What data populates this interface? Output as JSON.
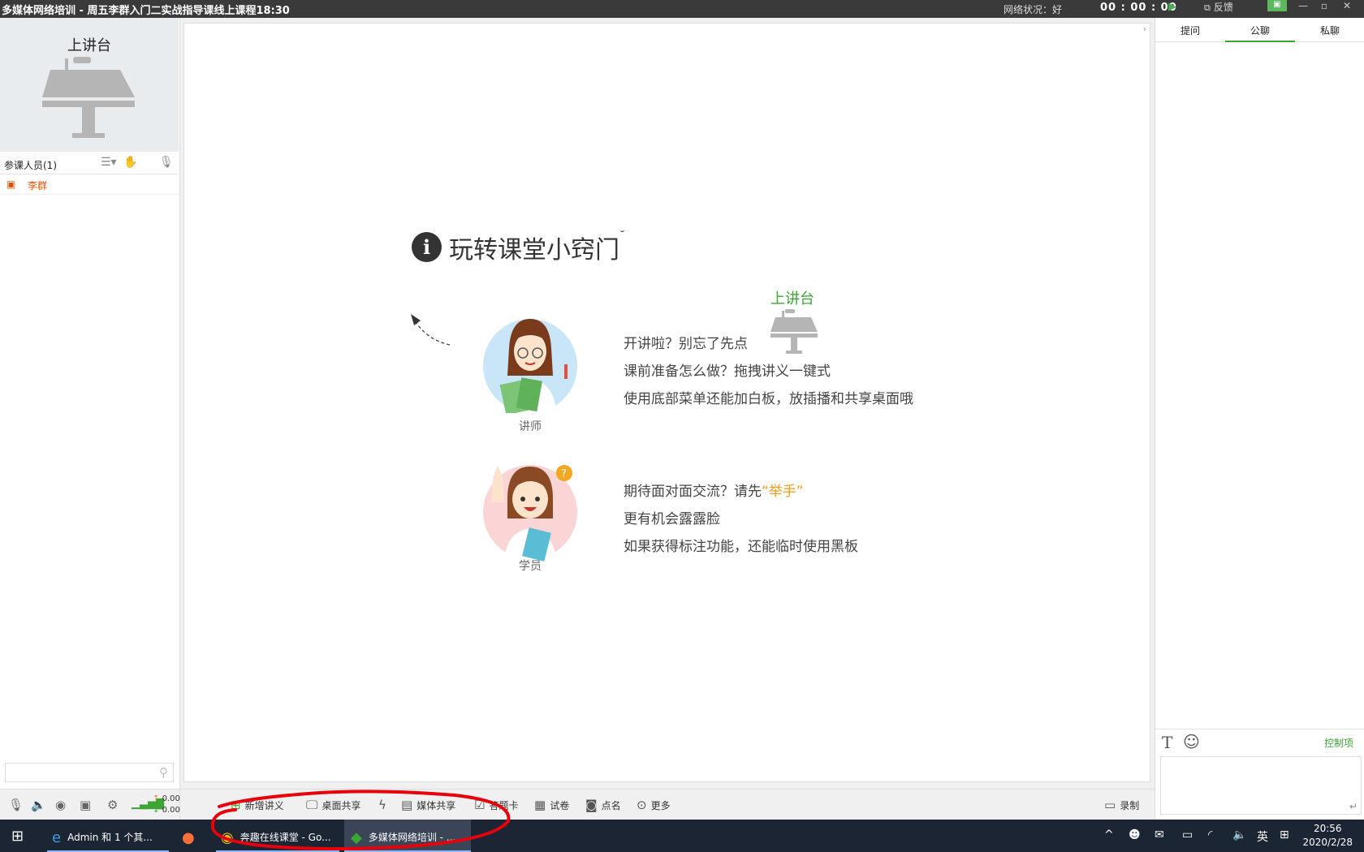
{
  "titlebar": {
    "title": "多媒体网络培训 - 周五李群入门二实战指导课线上课程18:30",
    "network_status": "网络状况：好",
    "timer": "00 : 00 : 00",
    "feedback": "反馈"
  },
  "left": {
    "podium_title": "上讲台",
    "participants_label": "参课人员(1)",
    "user": "李群",
    "search_placeholder": ""
  },
  "board": {
    "title": "玩转课堂小窍门",
    "podium_label": "上讲台",
    "teacher_role": "讲师",
    "student_role": "学员",
    "teacher_lines": [
      "开讲啦？别忘了先点",
      "课前准备怎么做？拖拽讲义一键式",
      "使用底部菜单还能加白板，放插播和共享桌面哦"
    ],
    "student_line1_prefix": "期待面对面交流？请先",
    "student_line1_highlight": "“举手”",
    "student_lines": [
      "更有机会露露脸",
      "如果获得标注功能，还能临时使用黑板"
    ]
  },
  "right": {
    "tabs": [
      "提问",
      "公聊",
      "私聊"
    ],
    "active_tab": 1,
    "control_label": "控制项"
  },
  "toolbar": {
    "upload_kbps": "0.00kbps",
    "download_kbps": "0.00kbps",
    "buttons": [
      "新增讲义",
      "桌面共享",
      "媒体共享",
      "答题卡",
      "试卷",
      "点名",
      "更多"
    ],
    "record": "录制"
  },
  "taskbar": {
    "items": [
      "Admin 和 1 个其...",
      "奔趣在线课堂 - Go...",
      "多媒体网络培训 - ..."
    ],
    "ime": "英",
    "time": "20:56",
    "date": "2020/2/28"
  },
  "colors": {
    "accent": "#3da535",
    "highlight": "#f49c1a",
    "annotation": "#e8000b"
  }
}
